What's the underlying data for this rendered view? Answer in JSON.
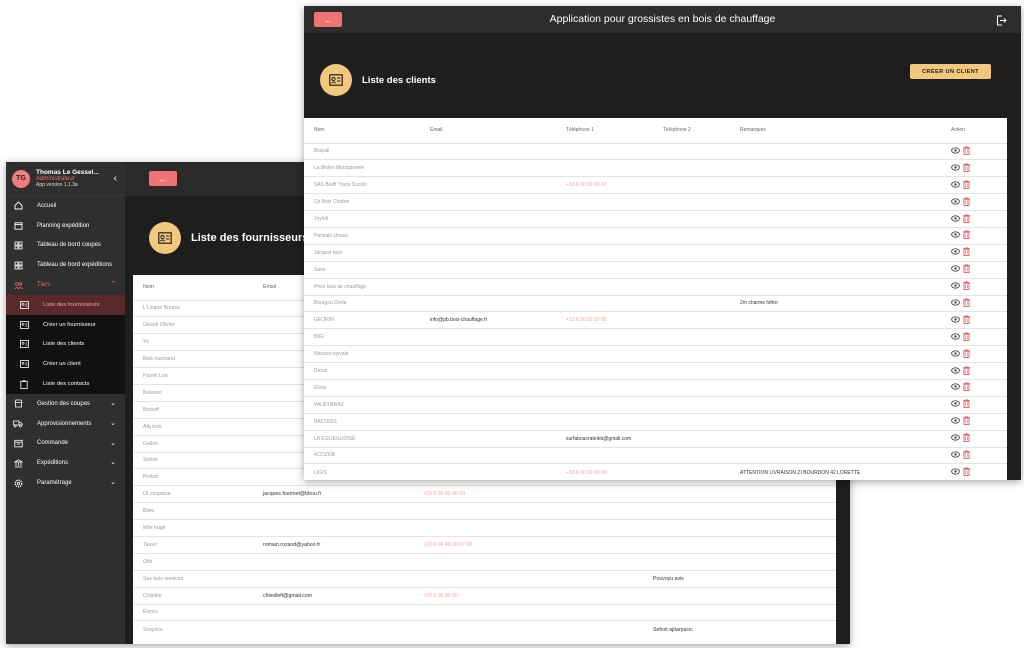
{
  "suppliers_window": {
    "profile": {
      "initials": "TG",
      "name": "Thomas Le Gessel...",
      "role": "Administrateur",
      "version": "App version 1.1.3a"
    },
    "nav": [
      {
        "label": "Accueil",
        "icon": "home-icon"
      },
      {
        "label": "Planning expédition",
        "icon": "calendar-icon"
      },
      {
        "label": "Tableau de bord coupes",
        "icon": "dashboard-icon"
      },
      {
        "label": "Tableau de bord expéditions",
        "icon": "dashboard-icon"
      },
      {
        "label": "Tiers",
        "icon": "users-icon"
      }
    ],
    "tiers_sub": [
      {
        "label": "Liste des fournisseurs",
        "icon": "contact-card-icon"
      },
      {
        "label": "Créer un fournisseur",
        "icon": "contact-card-icon"
      },
      {
        "label": "Liste des clients",
        "icon": "contact-card-icon"
      },
      {
        "label": "Créer un client",
        "icon": "contact-card-icon"
      },
      {
        "label": "Liste des contacts",
        "icon": "clipboard-icon"
      }
    ],
    "nav_bottom": [
      {
        "label": "Gestion des coupes",
        "icon": "store-icon"
      },
      {
        "label": "Approvisionnements",
        "icon": "truck-icon"
      },
      {
        "label": "Commande",
        "icon": "order-icon"
      },
      {
        "label": "Expéditions",
        "icon": "bank-icon"
      },
      {
        "label": "Paramétrage",
        "icon": "gear-icon"
      }
    ],
    "page_title": "Liste des fournisseurs",
    "columns": [
      "Nom",
      "Email",
      "",
      "",
      "",
      ""
    ],
    "rows": [
      [
        "L'Lsique Bresse",
        "",
        "",
        "",
        ""
      ],
      [
        "Girault Olivier",
        "",
        "",
        "",
        ""
      ],
      [
        "Yo",
        "",
        "",
        "",
        ""
      ],
      [
        "Bois marnand",
        "",
        "",
        "",
        ""
      ],
      [
        "Pantel Loic",
        "",
        "",
        "",
        ""
      ],
      [
        "Boisson",
        "",
        "",
        "",
        ""
      ],
      [
        "Boisoff",
        "",
        "",
        "",
        ""
      ],
      [
        "Afg bois",
        "",
        "",
        "",
        ""
      ],
      [
        "Gallon",
        "",
        "",
        "",
        ""
      ],
      [
        "Sofoie",
        "",
        "",
        "",
        ""
      ],
      [
        "Probst",
        "",
        "",
        "",
        ""
      ],
      [
        "Gf coupaize",
        "jacques.fourmet@bbou.fr",
        "+33 6 00 02 00 00",
        "",
        ""
      ],
      [
        "Bixio",
        "",
        "",
        "",
        ""
      ],
      [
        "Mile hugé",
        "",
        "",
        "",
        ""
      ],
      [
        "Tauvo",
        "romain.rozand@yahoo.fr",
        "+33 6 00 40 00 07 00",
        "",
        ""
      ],
      [
        "Olbi",
        "",
        "",
        "",
        ""
      ],
      [
        "Sas bois services",
        "",
        "",
        "Pouvoyu avis",
        ""
      ],
      [
        "Chisolie",
        "chisolleft@gmail.com",
        "+33 6 00 00 00",
        "",
        ""
      ],
      [
        "Elvora",
        "",
        "",
        "",
        ""
      ],
      [
        "Snojoize",
        "",
        "",
        "Sefcet ajdarpacic",
        ""
      ]
    ]
  },
  "clients_window": {
    "app_title": "Application pour grossistes en bois de chauffage",
    "page_title": "Liste des clients",
    "create_label": "CRÉER UN CLIENT",
    "columns": [
      "Nom",
      "Email",
      "Téléphone 1",
      "Téléphone 2",
      "Remarques",
      "Action"
    ],
    "rows": [
      [
        "Brayall",
        "",
        "",
        "",
        ""
      ],
      [
        "La Bloles Morzigionele",
        "",
        "",
        "",
        ""
      ],
      [
        "SAS Bluffi Trans Socolo",
        "",
        "+33 6 00 00 00 07",
        "",
        ""
      ],
      [
        "Cri Bois Chabot",
        "",
        "",
        "",
        ""
      ],
      [
        "Joylott",
        "",
        "",
        "",
        ""
      ],
      [
        "Pamlaio Urassi",
        "",
        "",
        "",
        ""
      ],
      [
        "Jacquet bois",
        "",
        "",
        "",
        ""
      ],
      [
        "Sano",
        "",
        "",
        "",
        ""
      ],
      [
        "Phso bois de chauffage",
        "",
        "",
        "",
        ""
      ],
      [
        "Bourgou Dorte",
        "",
        "",
        "",
        "2m charme hêtre"
      ],
      [
        "GEORIN",
        "info@pb.bois-chauffage.fr",
        "+33 6 00 00 00 05",
        "",
        ""
      ],
      [
        "BIGI",
        "",
        "",
        "",
        ""
      ],
      [
        "Nicusco sylvale",
        "",
        "",
        "",
        ""
      ],
      [
        "Droux",
        "",
        "",
        "",
        ""
      ],
      [
        "Elvos",
        "",
        "",
        "",
        ""
      ],
      [
        "PAUDI BRAZ",
        "",
        "",
        "",
        ""
      ],
      [
        "BACOGIS",
        "",
        "",
        "",
        ""
      ],
      [
        "LA EGLIEGUOISE",
        "",
        "surfaboucrateleb@gmail.com",
        "",
        ""
      ],
      [
        "ACOZOB",
        "",
        "",
        "",
        ""
      ],
      [
        "LIGIS",
        "",
        "+33 6 00 00 00 00",
        "",
        "ATTENTION LIVRAISON ZI BOURDON 42 LORETTE"
      ]
    ]
  }
}
